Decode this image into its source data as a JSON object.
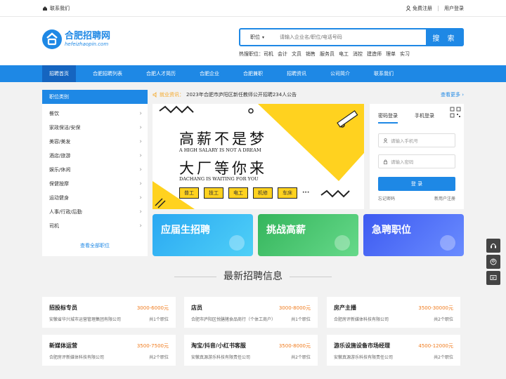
{
  "topbar": {
    "contact": "联系我们",
    "register": "免费注册",
    "login": "用户登录"
  },
  "logo": {
    "title": "合肥招聘网",
    "url": "hefeizhaopin.com"
  },
  "search": {
    "type": "职位",
    "placeholder": "请输入企业名/职位/电话号码",
    "button": "搜 索"
  },
  "hot": {
    "label": "热搜职位：",
    "items": [
      "司机",
      "会计",
      "文员",
      "销售",
      "服务员",
      "电工",
      "消控",
      "建造师",
      "理单",
      "实习"
    ]
  },
  "nav": [
    "招聘首页",
    "合肥招聘列表",
    "合肥人才简历",
    "合肥企业",
    "合肥兼职",
    "招聘资讯",
    "公司简介",
    "联系我们"
  ],
  "categories": {
    "title": "职位类别",
    "items": [
      "餐饮",
      "家政保洁/安保",
      "美容/美发",
      "酒店/旅游",
      "娱乐/休闲",
      "保健按摩",
      "运动健身",
      "人事/行政/后勤",
      "司机"
    ],
    "more": "查看全部职位"
  },
  "notice": {
    "tag": "就业资讯：",
    "text": "2023年合肥市庐阳区新任教师公开招聘234人公告",
    "more": "查看更多"
  },
  "banner": {
    "line1": "高薪不是梦",
    "en1": "A HIGH SALARY IS NOT A DREAM",
    "line2": "大厂等你来",
    "en2": "DACHANG IS WAITING FOR YOU",
    "tags": [
      "普工",
      "技工",
      "电工",
      "机修",
      "车床"
    ],
    "dots": "···"
  },
  "login": {
    "tab_pwd": "密码登录",
    "tab_phone": "手机登录",
    "phone_placeholder": "请输入手机号",
    "pwd_placeholder": "请输入密码",
    "button": "登 录",
    "forgot": "忘记密码",
    "register": "新用户注册"
  },
  "promos": [
    {
      "label": "应届生招聘",
      "color": "#29b6f6"
    },
    {
      "label": "挑战高薪",
      "color": "#43c46a"
    },
    {
      "label": "急聘职位",
      "color": "#4a6cf7"
    }
  ],
  "section_title": "最新招聘信息",
  "jobs": [
    {
      "title": "招投标专员",
      "salary": "3000-6000元",
      "company": "安徽省华兴城市运营管理集团有限公司",
      "count": "共1个职位"
    },
    {
      "title": "店员",
      "salary": "3000-8000元",
      "company": "合肥市庐阳区悦膳猪食品商行（个体工商户）",
      "count": "共1个职位"
    },
    {
      "title": "房产主播",
      "salary": "3500-30000元",
      "company": "合肥房评新媒体科技有限公司",
      "count": "共2个职位"
    },
    {
      "title": "新媒体运营",
      "salary": "3500-7500元",
      "company": "合肥房评新媒体科技有限公司",
      "count": "共2个职位"
    },
    {
      "title": "淘宝/抖音/小红书客服",
      "salary": "3500-8000元",
      "company": "安徽真源游乐科技有限责任公司",
      "count": "共2个职位"
    },
    {
      "title": "游乐设施设备市场经理",
      "salary": "4500-12000元",
      "company": "安徽真源游乐科技有限责任公司",
      "count": "共2个职位"
    }
  ],
  "colors": {
    "primary": "#1e88e5",
    "salary": "#f07b1d",
    "banner_yellow": "#ffd21f"
  }
}
